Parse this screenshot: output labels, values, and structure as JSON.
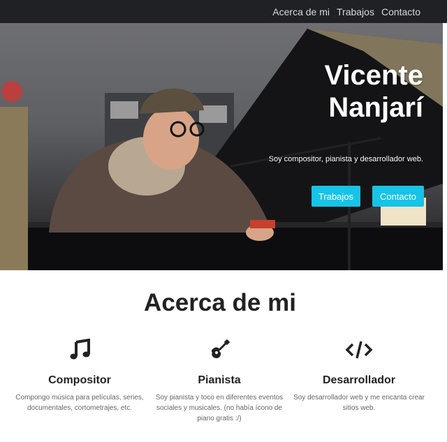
{
  "nav": {
    "items": [
      "Acerca de mi",
      "Trabajos",
      "Contacto"
    ]
  },
  "hero": {
    "title_line1": "Vicente",
    "title_line2": "Nanjarí",
    "subtitle": "Soy compositor, pianista y desarrollador web.",
    "buttons": [
      "Trabajos",
      "Contacto"
    ],
    "accent_color": "#17c3e6"
  },
  "about": {
    "title": "Acerca de mi",
    "features": [
      {
        "icon": "music-note-icon",
        "title": "Compositor",
        "text": "Compongo música para películas, series, documentales, cortometrajes, etc."
      },
      {
        "icon": "guitar-icon",
        "title": "Pianista",
        "text": "Soy pianista y toco en diferentes eventos sociales y musicales. (no había ícono de piano gratis :/)"
      },
      {
        "icon": "code-icon",
        "title": "Desarrollador",
        "text": "Soy desarrollador web y me encanta crear sitios web."
      }
    ]
  }
}
